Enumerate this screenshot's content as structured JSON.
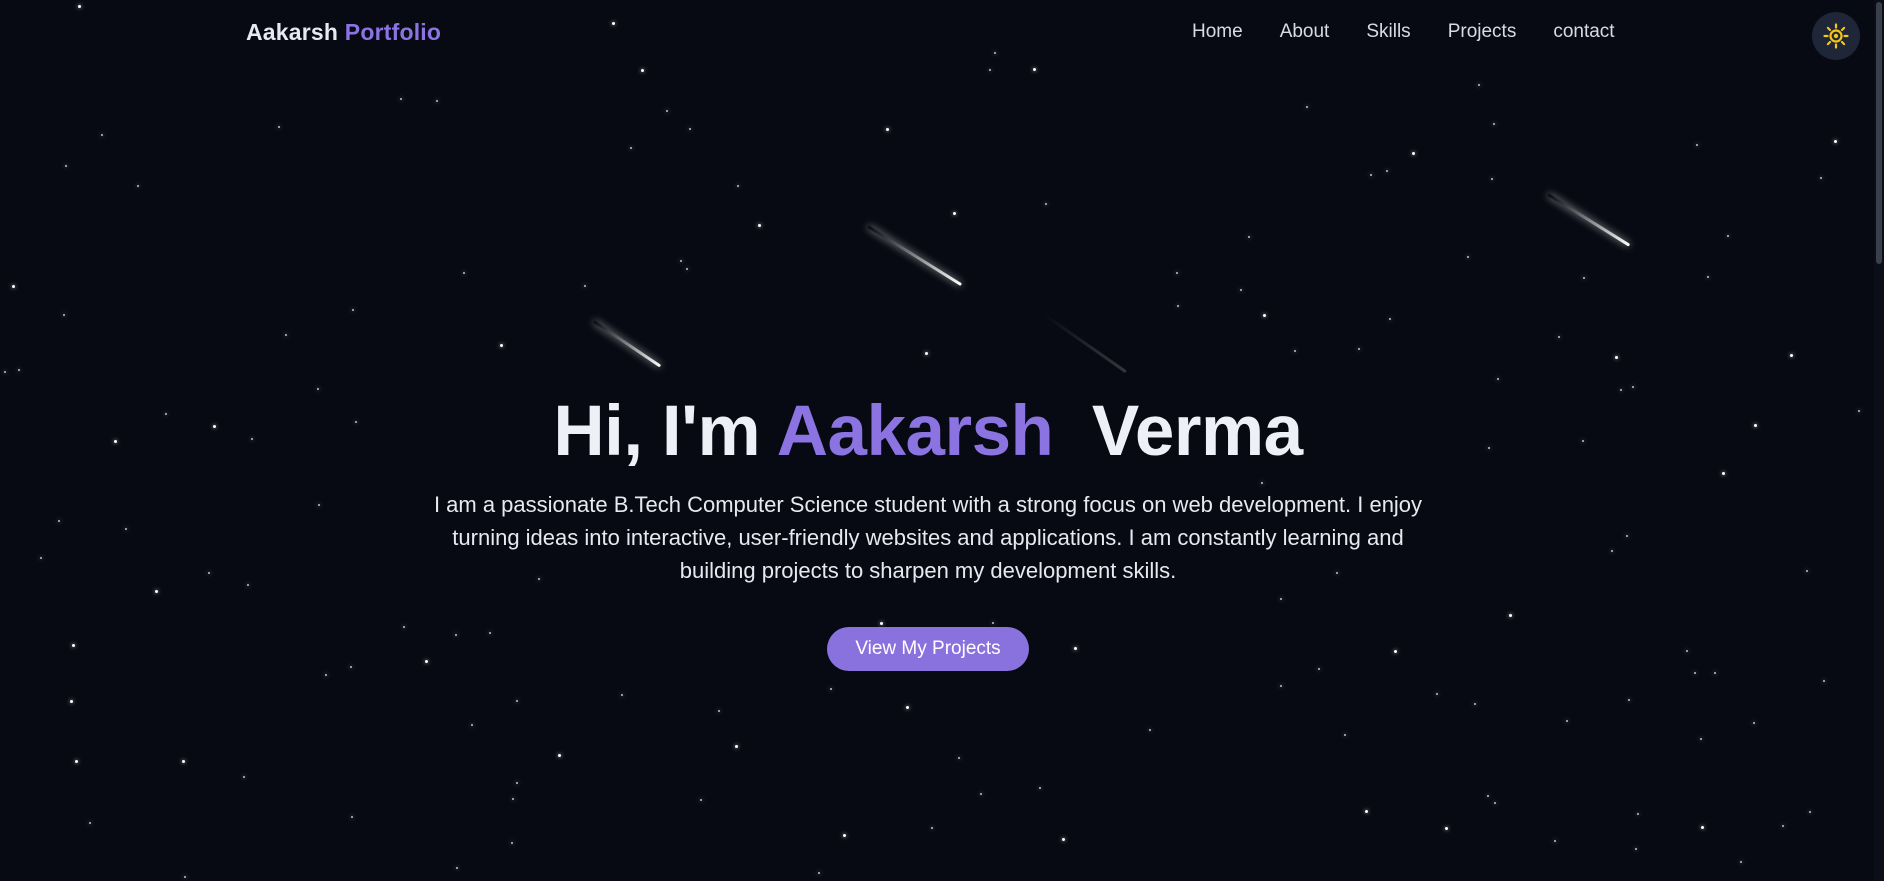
{
  "header": {
    "brand_first": "Aakarsh",
    "brand_second": "Portfolio",
    "nav": [
      {
        "label": "Home"
      },
      {
        "label": "About"
      },
      {
        "label": "Skills"
      },
      {
        "label": "Projects"
      },
      {
        "label": "contact"
      }
    ],
    "theme_toggle_icon": "sun-icon"
  },
  "hero": {
    "greeting": "Hi, I'm",
    "first_name": "Aakarsh",
    "last_name": "Verma",
    "description": "I am a passionate B.Tech Computer Science student with a strong focus on web development. I enjoy turning ideas into interactive, user-friendly websites and applications. I am constantly learning and building projects to sharpen my development skills.",
    "cta_label": "View My Projects"
  },
  "colors": {
    "background": "#070a12",
    "accent": "#8b74e2",
    "button": "#8a72de",
    "toggle_bg": "#1f2637",
    "sun": "#f5c518"
  }
}
